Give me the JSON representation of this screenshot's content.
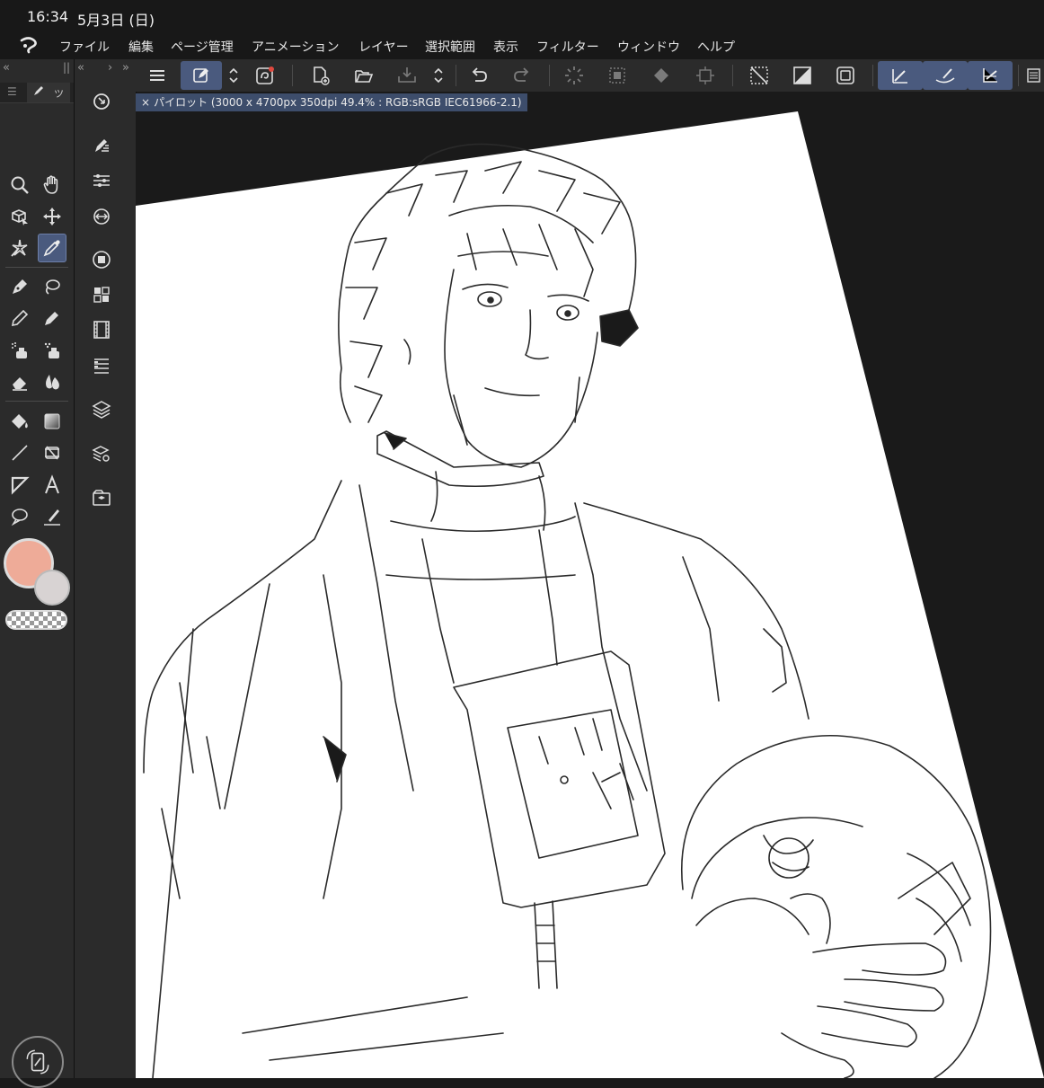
{
  "status_bar": {
    "time": "16:34",
    "date": "5月3日 (日)"
  },
  "menu": [
    "ファイル",
    "編集",
    "ページ管理",
    "アニメーション",
    "レイヤー",
    "選択範囲",
    "表示",
    "フィルター",
    "ウィンドウ",
    "ヘルプ"
  ],
  "tool_palette": {
    "collapse": "«",
    "grip": "||",
    "tab_label": "ツ",
    "active_tool": "eyedropper"
  },
  "sub_palette": {
    "collapse_left": "«",
    "chevron_right": "›",
    "collapse_right": "»"
  },
  "colors": {
    "main": "#eeab98",
    "sub": "#d8d3d3",
    "accent": "#4a5a7e",
    "record_dot": "#e0493f"
  },
  "document_tab": {
    "close": "×",
    "label": "パイロット (3000 x 4700px 350dpi 49.4% : RGB:sRGB IEC61966-2.1)"
  }
}
